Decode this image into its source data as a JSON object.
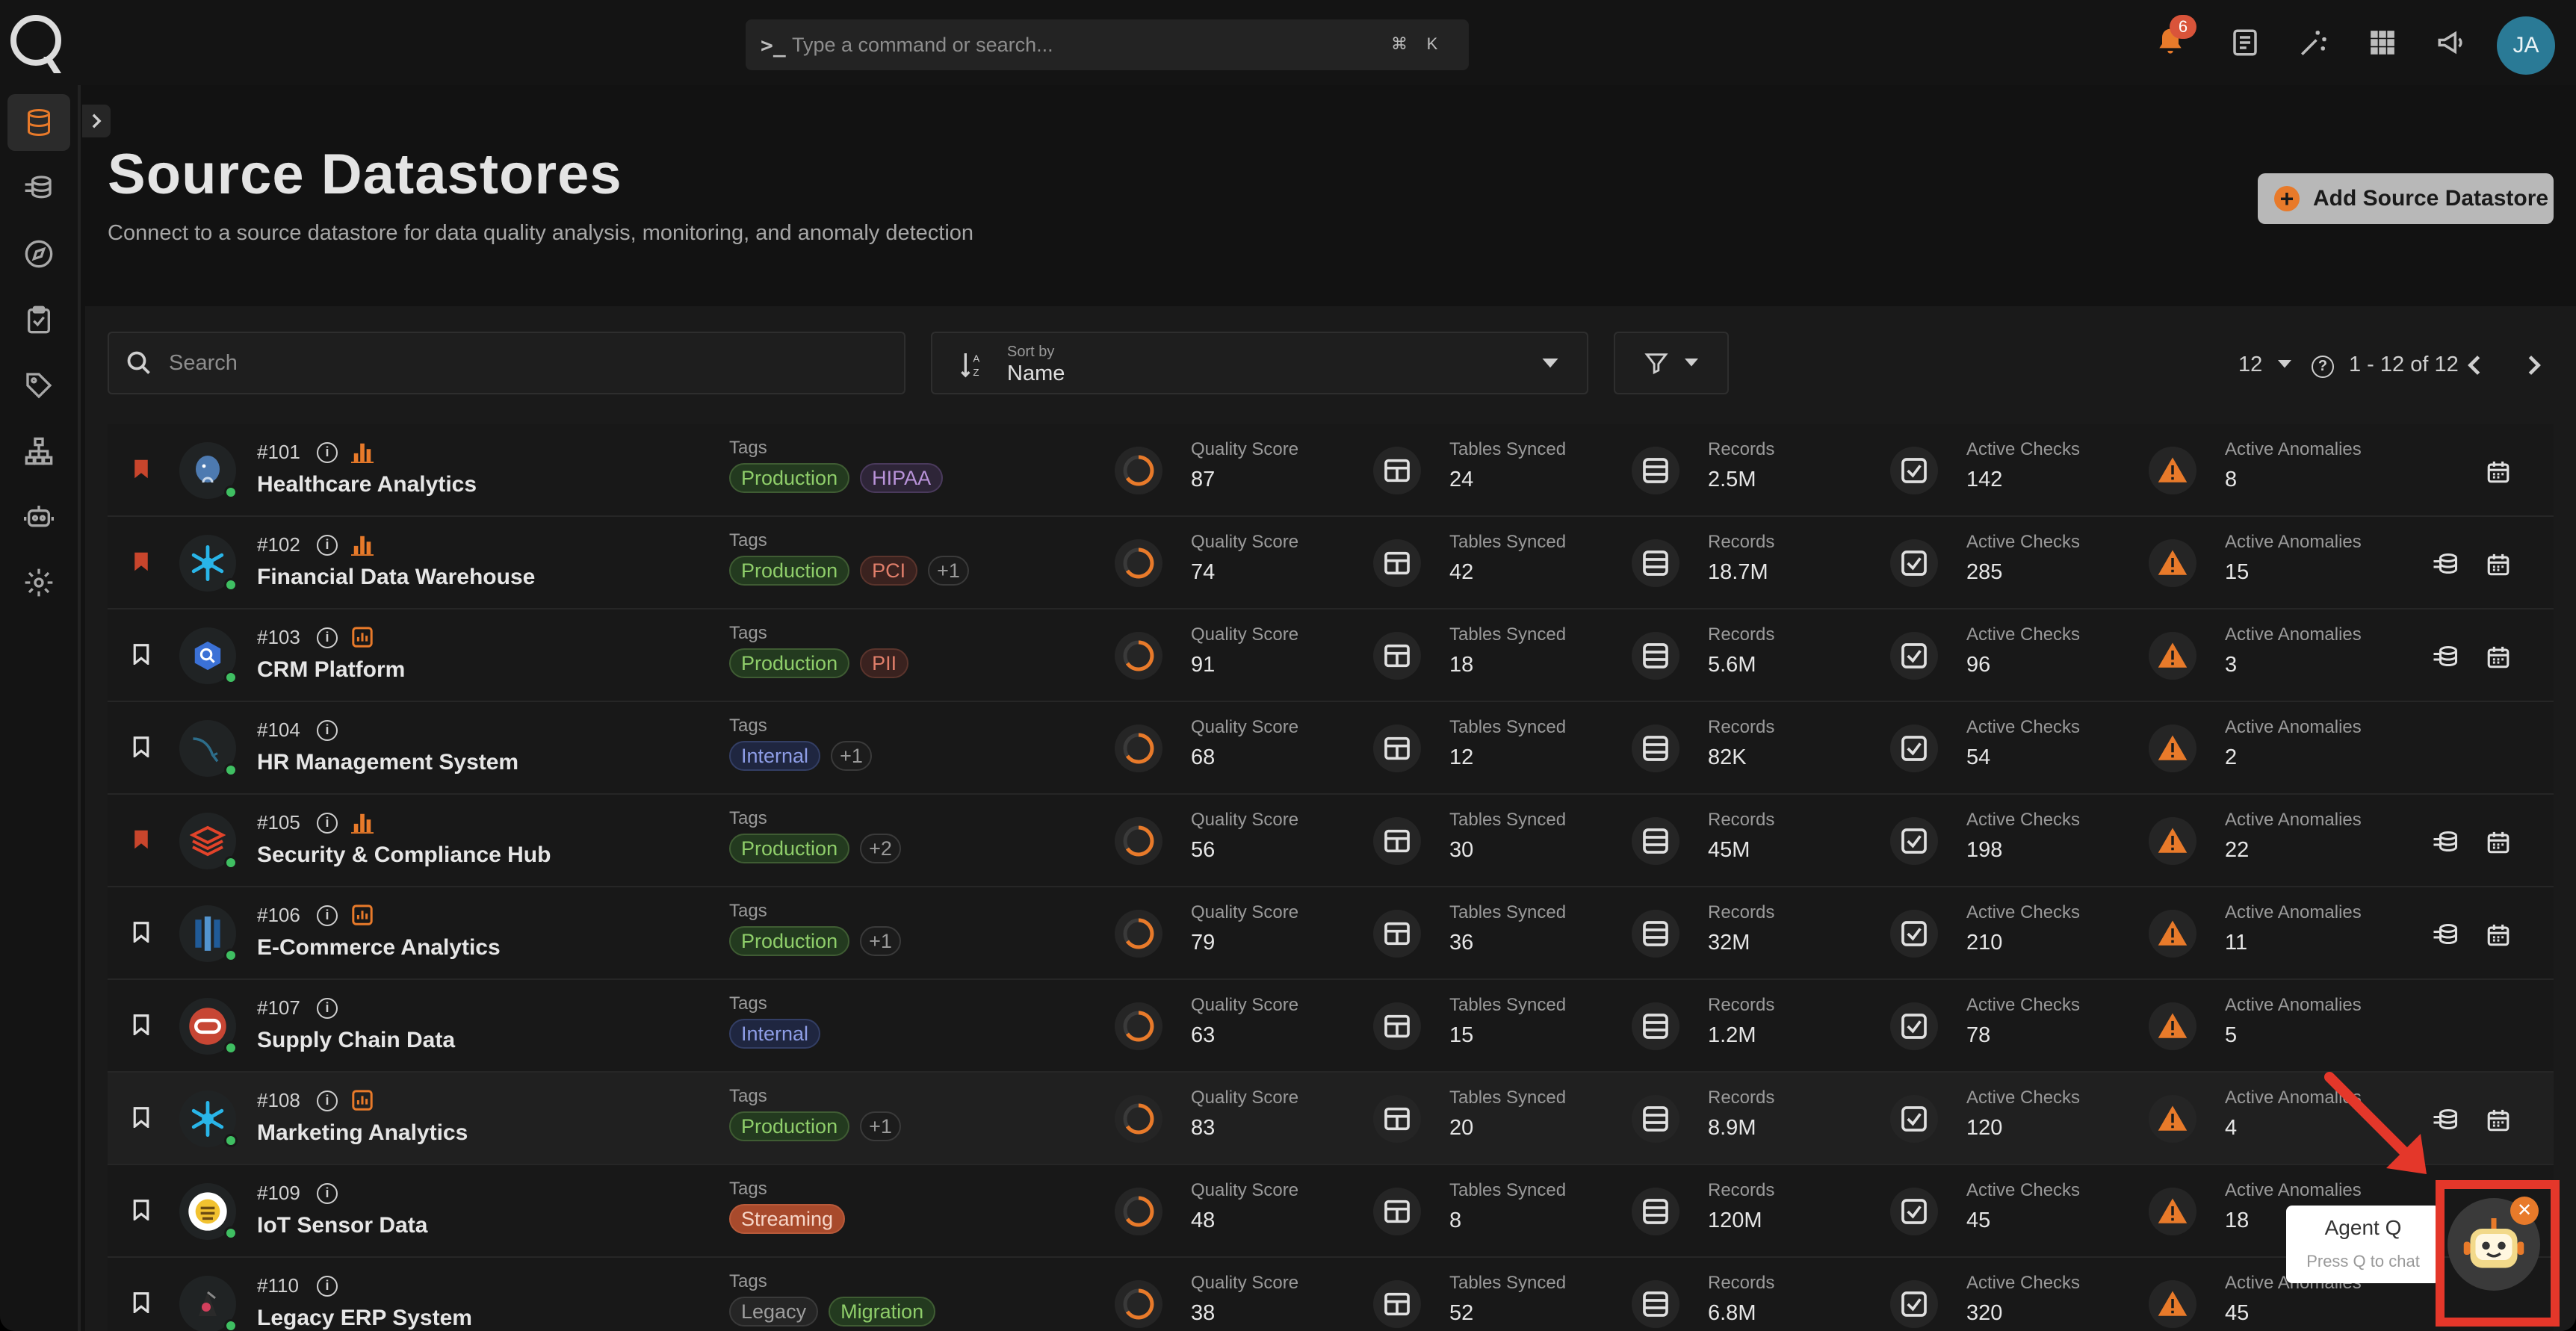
{
  "topbar": {
    "search_placeholder": "Type a command or search...",
    "kbd_cmd": "⌘",
    "kbd_k": "K",
    "notification_count": "6",
    "avatar_initials": "JA"
  },
  "page": {
    "title": "Source Datastores",
    "subtitle": "Connect to a source datastore for data quality analysis, monitoring, and anomaly detection",
    "add_button": "Add Source Datastore"
  },
  "filters": {
    "search_placeholder": "Search",
    "sort_label": "Sort by",
    "sort_value": "Name",
    "page_size": "12",
    "range": "1 - 12 of 12"
  },
  "labels": {
    "tags": "Tags",
    "quality": "Quality Score",
    "tables": "Tables Synced",
    "records": "Records",
    "checks": "Active Checks",
    "anomalies": "Active Anomalies"
  },
  "rows": [
    {
      "id": "#101",
      "name": "Healthcare Analytics",
      "bookmarked": true,
      "logo": "postgres-icon",
      "tags": [
        {
          "t": "Production",
          "c": "green"
        },
        {
          "t": "HIPAA",
          "c": "purple"
        }
      ],
      "more": "",
      "quality": "87",
      "tables": "24",
      "records": "2.5M",
      "checks": "142",
      "anomalies": "8",
      "actions": [
        "calendar"
      ]
    },
    {
      "id": "#102",
      "name": "Financial Data Warehouse",
      "bookmarked": true,
      "logo": "snowflake-icon",
      "tags": [
        {
          "t": "Production",
          "c": "green"
        },
        {
          "t": "PCI",
          "c": "red"
        }
      ],
      "more": "+1",
      "quality": "74",
      "tables": "42",
      "records": "18.7M",
      "checks": "285",
      "anomalies": "15",
      "actions": [
        "enrich",
        "calendar"
      ]
    },
    {
      "id": "#103",
      "name": "CRM Platform",
      "bookmarked": false,
      "logo": "bigquery-icon",
      "tags": [
        {
          "t": "Production",
          "c": "green"
        },
        {
          "t": "PII",
          "c": "red"
        }
      ],
      "more": "",
      "quality": "91",
      "tables": "18",
      "records": "5.6M",
      "checks": "96",
      "anomalies": "3",
      "actions": [
        "enrich",
        "calendar"
      ]
    },
    {
      "id": "#104",
      "name": "HR Management System",
      "bookmarked": false,
      "logo": "mysql-icon",
      "tags": [
        {
          "t": "Internal",
          "c": "blue"
        }
      ],
      "more": "+1",
      "quality": "68",
      "tables": "12",
      "records": "82K",
      "checks": "54",
      "anomalies": "2",
      "actions": []
    },
    {
      "id": "#105",
      "name": "Security & Compliance Hub",
      "bookmarked": true,
      "logo": "databricks-icon",
      "tags": [
        {
          "t": "Production",
          "c": "green"
        }
      ],
      "more": "+2",
      "quality": "56",
      "tables": "30",
      "records": "45M",
      "checks": "198",
      "anomalies": "22",
      "actions": [
        "enrich",
        "calendar"
      ]
    },
    {
      "id": "#106",
      "name": "E-Commerce Analytics",
      "bookmarked": false,
      "logo": "redshift-icon",
      "tags": [
        {
          "t": "Production",
          "c": "green"
        }
      ],
      "more": "+1",
      "quality": "79",
      "tables": "36",
      "records": "32M",
      "checks": "210",
      "anomalies": "11",
      "actions": [
        "enrich",
        "calendar"
      ]
    },
    {
      "id": "#107",
      "name": "Supply Chain Data",
      "bookmarked": false,
      "logo": "oracle-icon",
      "tags": [
        {
          "t": "Internal",
          "c": "blue"
        }
      ],
      "more": "",
      "quality": "63",
      "tables": "15",
      "records": "1.2M",
      "checks": "78",
      "anomalies": "5",
      "actions": []
    },
    {
      "id": "#108",
      "name": "Marketing Analytics",
      "bookmarked": false,
      "logo": "snowflake-icon",
      "tags": [
        {
          "t": "Production",
          "c": "green"
        }
      ],
      "more": "+1",
      "quality": "83",
      "tables": "20",
      "records": "8.9M",
      "checks": "120",
      "anomalies": "4",
      "actions": [
        "enrich",
        "calendar"
      ]
    },
    {
      "id": "#109",
      "name": "IoT Sensor Data",
      "bookmarked": false,
      "logo": "hive-icon",
      "tags": [
        {
          "t": "Streaming",
          "c": "orange"
        }
      ],
      "more": "",
      "quality": "48",
      "tables": "8",
      "records": "120M",
      "checks": "45",
      "anomalies": "18",
      "actions": []
    },
    {
      "id": "#110",
      "name": "Legacy ERP System",
      "bookmarked": false,
      "logo": "db2-icon",
      "tags": [
        {
          "t": "Legacy",
          "c": "gray"
        },
        {
          "t": "Migration",
          "c": "green"
        }
      ],
      "more": "",
      "quality": "38",
      "tables": "52",
      "records": "6.8M",
      "checks": "320",
      "anomalies": "45",
      "actions": []
    }
  ],
  "agent": {
    "title": "Agent Q",
    "hint": "Press Q to chat"
  },
  "colors": {
    "accent": "#e87a2a",
    "highlight": "#e4372a",
    "status_ok": "#3fbf62"
  }
}
